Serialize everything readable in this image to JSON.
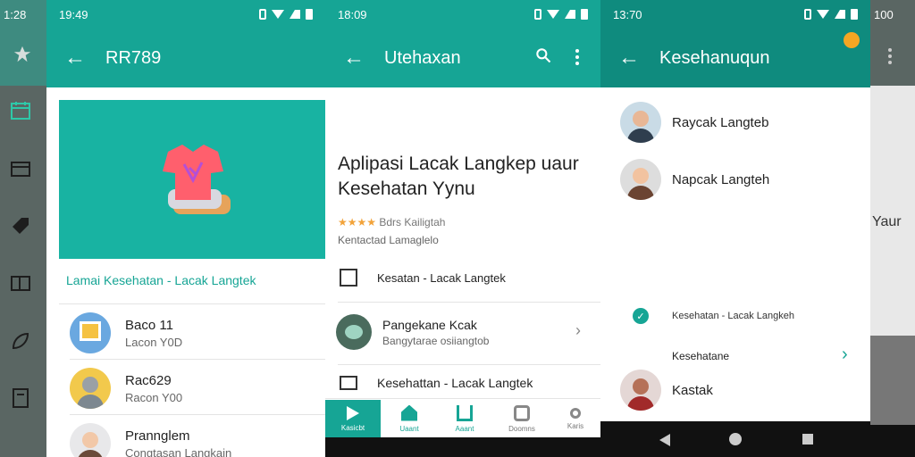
{
  "colors": {
    "teal": "#16a595",
    "teal_dark": "#0f8b7e",
    "rail": "#5d6a67",
    "white": "#ffffff"
  },
  "screen1": {
    "status_time": "1:28",
    "rail_icons": [
      "star-icon",
      "calendar-icon",
      "folder-icon",
      "tag-icon",
      "split-icon",
      "leaf-icon",
      "document-icon"
    ]
  },
  "screen2": {
    "status_time": "19:49",
    "title": "RR789",
    "banner_caption": "Lamai Kesehatan - Lacak Langtek",
    "items": [
      {
        "title": "Baco 11",
        "subtitle": "Lacon Y0D"
      },
      {
        "title": "Rac629",
        "subtitle": "Racon Y00"
      },
      {
        "title": "Prannglem",
        "subtitle": "Congtasan Langkain"
      }
    ]
  },
  "screen3": {
    "status_time": "18:09",
    "title": "Utehaxan",
    "headline": "Aplipasi Lacak Langkep uaur Kesehatan Yynu",
    "rating_stars": "★★★★",
    "rating_text": "Bdrs Kailigtah",
    "subtitle": "Kentactad Lamaglelo",
    "rows": [
      {
        "title": "Kesatan - Lacak Langtek"
      },
      {
        "title": "Pangekane Kcak",
        "subtitle": "Bangytarae osiiangtob"
      },
      {
        "title": "Kesehattan - Lacak Langtek"
      }
    ],
    "nav": [
      {
        "label": "Kasicbt"
      },
      {
        "label": "Uaant"
      },
      {
        "label": "Aaant"
      },
      {
        "label": "Doomns"
      },
      {
        "label": "Karis"
      }
    ]
  },
  "screen4": {
    "status_time": "13:70",
    "title": "Kesehanuqun",
    "contacts": [
      {
        "name": "Raycak Langteb"
      },
      {
        "name": "Napcak Langteh"
      }
    ],
    "check_label": "Kesehatan - Lacak Langkeh",
    "section_label": "Kesehatane",
    "last_contact": "Kastak"
  },
  "screen5": {
    "status_time": "100",
    "partial_text": "Yaur"
  }
}
